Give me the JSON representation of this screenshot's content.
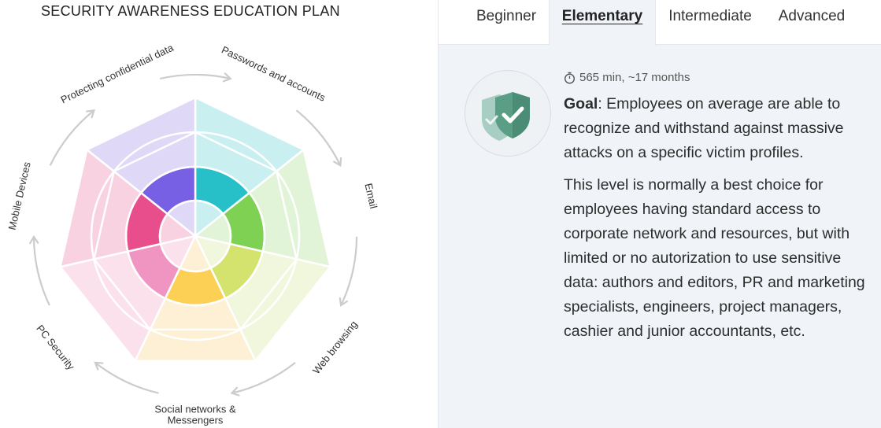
{
  "plan": {
    "title": "SECURITY AWARENESS EDUCATION PLAN",
    "sectors": [
      {
        "label": "Passwords and accounts",
        "colors": [
          "#c9eff1",
          "#c9eff1",
          "#28c0c8"
        ]
      },
      {
        "label": "Email",
        "colors": [
          "#e2f4d8",
          "#e2f4d8",
          "#7ed153"
        ]
      },
      {
        "label": "Web browsing",
        "colors": [
          "#f1f7dd",
          "#f1f7dd",
          "#d3e36d"
        ]
      },
      {
        "label": "Social networks & Messengers",
        "colors": [
          "#fdf0d4",
          "#fdf0d4",
          "#fccf55"
        ]
      },
      {
        "label": "PC Security",
        "colors": [
          "#fbe1ec",
          "#fbe1ec",
          "#f095c1"
        ]
      },
      {
        "label": "Mobile Devices",
        "colors": [
          "#f9d2e1",
          "#f9d2e1",
          "#e84d8c"
        ]
      },
      {
        "label": "Protecting confidential data",
        "colors": [
          "#dfd8f6",
          "#dfd8f6",
          "#7760e3"
        ]
      }
    ]
  },
  "tabs": [
    {
      "label": "Beginner",
      "active": false
    },
    {
      "label": "Elementary",
      "active": true
    },
    {
      "label": "Intermediate",
      "active": false
    },
    {
      "label": "Advanced",
      "active": false
    }
  ],
  "level": {
    "duration": "565 min, ~17 months",
    "goal_label": "Goal",
    "goal_text": ": Employees on average are able to recognize and withstand against massive attacks on a specific victim profiles.",
    "description": "This level is normally a best choice for employees having standard access to corporate network and resources, but with limited or no autorization to use sensitive data: authors and editors, PR and marketing specialists, engineers, project managers, cashier and junior accountants, etc."
  },
  "icons": {
    "timer": "stopwatch-icon",
    "badge": "shield-check-icon"
  },
  "colors": {
    "panel_bg": "#f0f4f8",
    "shield": "#5a9e86",
    "arrow": "#cccccc"
  }
}
